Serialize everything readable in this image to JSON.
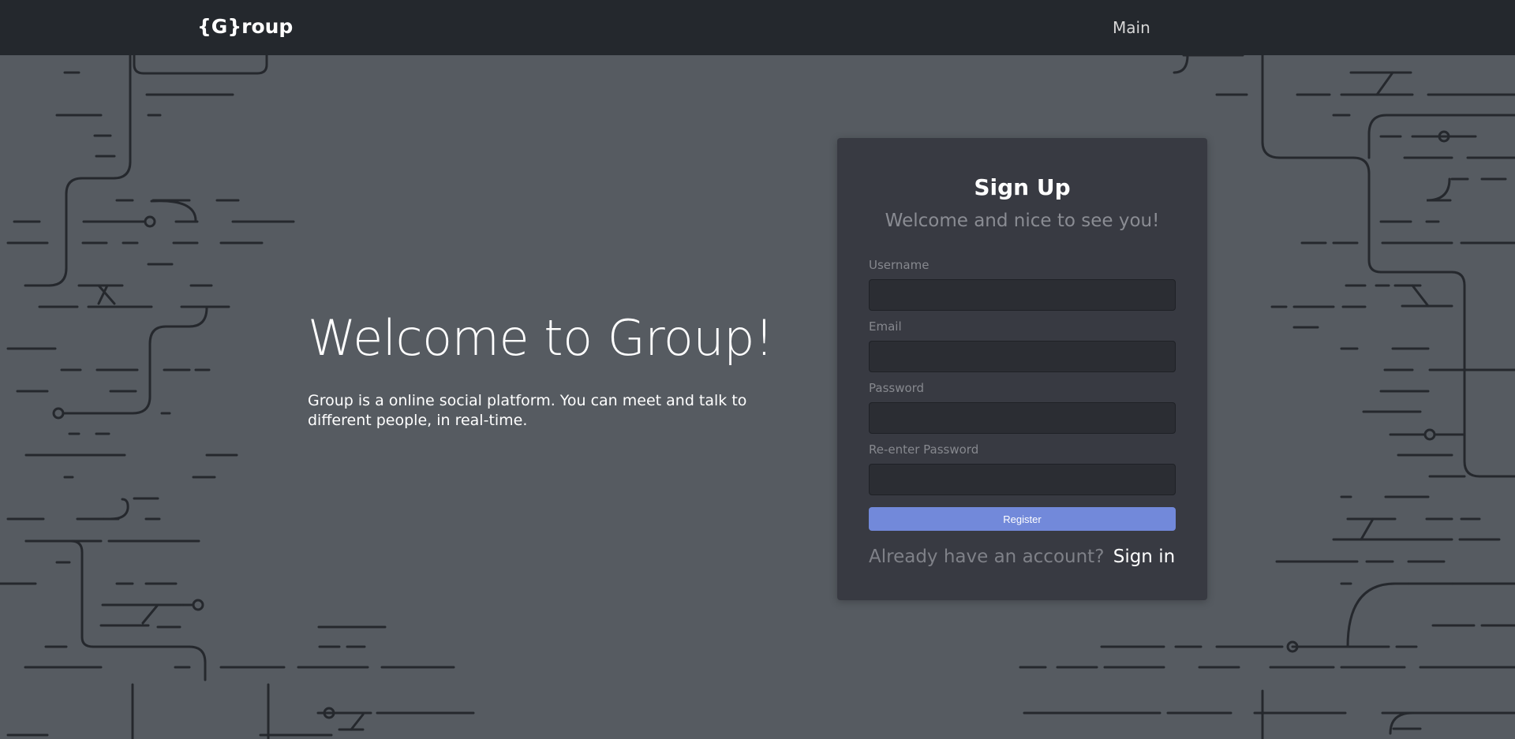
{
  "navbar": {
    "brand": "{G}roup",
    "links": [
      {
        "label": "Main"
      }
    ]
  },
  "hero": {
    "title": "Welcome to Group!",
    "description": "Group is a online social platform. You can meet and talk to different people, in real-time."
  },
  "signup": {
    "title": "Sign Up",
    "subtitle": "Welcome and nice to see you!",
    "fields": [
      {
        "label": "Username",
        "value": "",
        "placeholder": ""
      },
      {
        "label": "Email",
        "value": "",
        "placeholder": ""
      },
      {
        "label": "Password",
        "value": "",
        "placeholder": ""
      },
      {
        "label": "Re-enter Password",
        "value": "",
        "placeholder": ""
      }
    ],
    "register_label": "Register",
    "signin_prompt": "Already have an account?",
    "signin_link": "Sign in"
  },
  "colors": {
    "background": "#565b61",
    "navbar": "#24282d",
    "card": "#383a42",
    "input": "#2b2d33",
    "accent": "#7289da",
    "pattern_line": "#25282d"
  }
}
